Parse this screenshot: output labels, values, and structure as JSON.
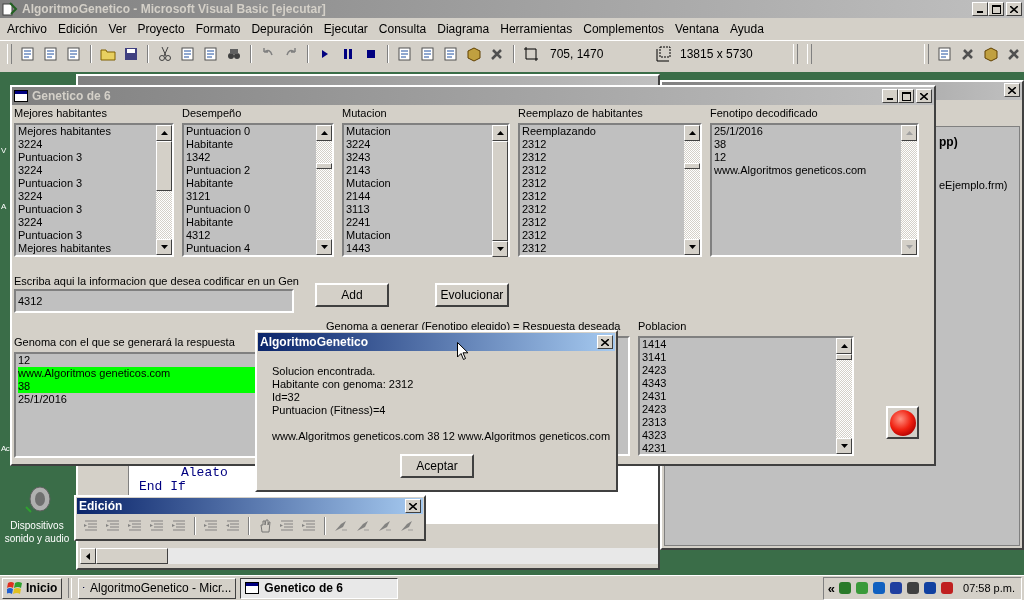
{
  "ide": {
    "title": "AlgoritmoGenetico - Microsoft Visual Basic [ejecutar]",
    "menu": [
      "Archivo",
      "Edición",
      "Ver",
      "Proyecto",
      "Formato",
      "Depuración",
      "Ejecutar",
      "Consulta",
      "Diagrama",
      "Herramientas",
      "Complementos",
      "Ventana",
      "Ayuda"
    ],
    "position": "705, 1470",
    "size": "13815 x 5730"
  },
  "desktop": {
    "labels": [
      "V",
      "A",
      "Ac"
    ],
    "icon_lines": [
      "Dispositivos",
      "sonido y audio"
    ]
  },
  "code_window": {
    "lines": [
      "Aleato",
      "End If"
    ]
  },
  "side_window": {
    "lines": [
      "pp)",
      "eEjemplo.frm)"
    ]
  },
  "form": {
    "title": "Genetico de 6",
    "lists": [
      {
        "label": "Mejores habitantes",
        "scroll_enabled": true,
        "items": [
          "Mejores habitantes",
          "3224",
          "Puntuacion 3",
          "3224",
          "Puntuacion 3",
          "3224",
          "Puntuacion 3",
          "3224",
          "Puntuacion 3",
          "Mejores habitantes"
        ]
      },
      {
        "label": "Desempeño",
        "scroll_enabled": true,
        "items": [
          "Puntuacion 0",
          "Habitante",
          "1342",
          "Puntuacion 2",
          "Habitante",
          "3121",
          "Puntuacion 0",
          "Habitante",
          "4312",
          "Puntuacion 4"
        ]
      },
      {
        "label": "Mutacion",
        "scroll_enabled": true,
        "items": [
          "Mutacion",
          "3224",
          "3243",
          "2143",
          "Mutacion",
          "2144",
          "3113",
          "2241",
          "Mutacion",
          "1443"
        ]
      },
      {
        "label": "Reemplazo de habitantes",
        "scroll_enabled": true,
        "items": [
          "Reemplazando",
          "2312",
          "2312",
          "2312",
          "2312",
          "2312",
          "2312",
          "2312",
          "2312",
          "2312"
        ]
      },
      {
        "label": "Fenotipo decodificado",
        "scroll_enabled": false,
        "items": [
          "25/1/2016",
          "38",
          "12",
          "www.Algoritmos geneticos.com"
        ]
      }
    ],
    "input": {
      "label": "Escriba aqui la informacion que desea codificar en un Gen",
      "value": "4312"
    },
    "buttons": [
      "Add",
      "Evolucionar"
    ],
    "genome": {
      "label": "Genoma con el que se generará la respuesta",
      "items": [
        {
          "text": "12",
          "selected": false
        },
        {
          "text": "www.Algoritmos geneticos.com",
          "selected": true
        },
        {
          "text": "38",
          "selected": true
        },
        {
          "text": "25/1/2016",
          "selected": false
        }
      ]
    },
    "target": {
      "label": "Genoma a generar (Fenotipo elegido) = Respuesta deseada"
    },
    "population": {
      "label": "Poblacion",
      "items": [
        "1414",
        "3141",
        "2423",
        "4343",
        "2431",
        "2423",
        "2313",
        "4323",
        "4231"
      ]
    }
  },
  "dialog": {
    "title": "AlgoritmoGenetico",
    "lines": [
      "Solucion encontrada.",
      "Habitante con genoma: 2312",
      "Id=32",
      "Puntuacion (Fitness)=4"
    ],
    "summary": "www.Algoritmos geneticos.com 38 12 www.Algoritmos geneticos.com",
    "button": "Aceptar"
  },
  "edit_toolbar": {
    "title": "Edición"
  },
  "taskbar": {
    "start": "Inicio",
    "tray_expand": "«",
    "tasks": [
      {
        "label": "AlgoritmoGenetico - Micr...",
        "selected": false
      },
      {
        "label": "Genetico de 6",
        "selected": true
      }
    ],
    "clock": "07:58 p.m."
  }
}
